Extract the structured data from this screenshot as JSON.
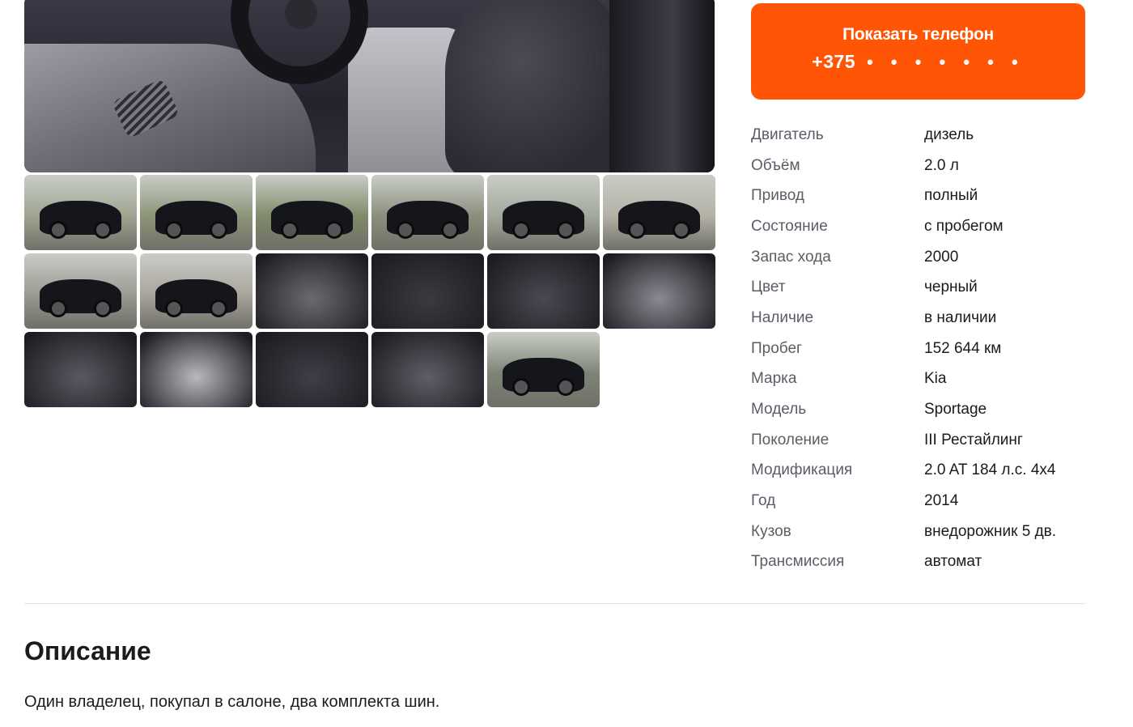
{
  "gallery": {
    "main_photo_alt": "Kia Sportage interior",
    "thumbnails": [
      {
        "kind": "exterior",
        "bg": "#9ea48f"
      },
      {
        "kind": "exterior",
        "bg": "#8d9478"
      },
      {
        "kind": "exterior",
        "bg": "#7f8a6a"
      },
      {
        "kind": "exterior",
        "bg": "#8a8f7c"
      },
      {
        "kind": "exterior",
        "bg": "#a3a89b"
      },
      {
        "kind": "exterior",
        "bg": "#b4b1a6"
      },
      {
        "kind": "exterior",
        "bg": "#9a9a92"
      },
      {
        "kind": "exterior",
        "bg": "#a9a59c"
      },
      {
        "kind": "interior",
        "bg": "#6c6a70"
      },
      {
        "kind": "interior",
        "bg": "#3b3a41"
      },
      {
        "kind": "interior",
        "bg": "#4a4850"
      },
      {
        "kind": "interior",
        "bg": "#8a8991"
      },
      {
        "kind": "interior",
        "bg": "#5a5860"
      },
      {
        "kind": "interior",
        "bg": "#b9b8bd"
      },
      {
        "kind": "interior",
        "bg": "#3f3d45"
      },
      {
        "kind": "interior",
        "bg": "#5f5e66"
      },
      {
        "kind": "exterior",
        "bg": "#7d8475"
      }
    ]
  },
  "phone_button": {
    "label": "Показать телефон",
    "prefix": "+375",
    "masked": "• • • • • • •"
  },
  "specs": [
    {
      "key": "Двигатель",
      "value": "дизель"
    },
    {
      "key": "Объём",
      "value": "2.0 л"
    },
    {
      "key": "Привод",
      "value": "полный"
    },
    {
      "key": "Состояние",
      "value": "с пробегом"
    },
    {
      "key": "Запас хода",
      "value": "2000"
    },
    {
      "key": "Цвет",
      "value": "черный"
    },
    {
      "key": "Наличие",
      "value": "в наличии"
    },
    {
      "key": "Пробег",
      "value": "152 644 км"
    },
    {
      "key": "Марка",
      "value": "Kia"
    },
    {
      "key": "Модель",
      "value": "Sportage"
    },
    {
      "key": "Поколение",
      "value": "III Рестайлинг"
    },
    {
      "key": "Модификация",
      "value": "2.0 AT 184 л.с. 4x4"
    },
    {
      "key": "Год",
      "value": "2014"
    },
    {
      "key": "Кузов",
      "value": "внедорожник 5 дв."
    },
    {
      "key": "Трансмиссия",
      "value": "автомат"
    }
  ],
  "description": {
    "title": "Описание",
    "text": "Один владелец, покупал в салоне, два комплекта шин."
  },
  "colors": {
    "accent": "#ff5505",
    "label_gray": "#5a5d66",
    "text": "#1b1b1b",
    "divider": "#e3e4e8"
  }
}
